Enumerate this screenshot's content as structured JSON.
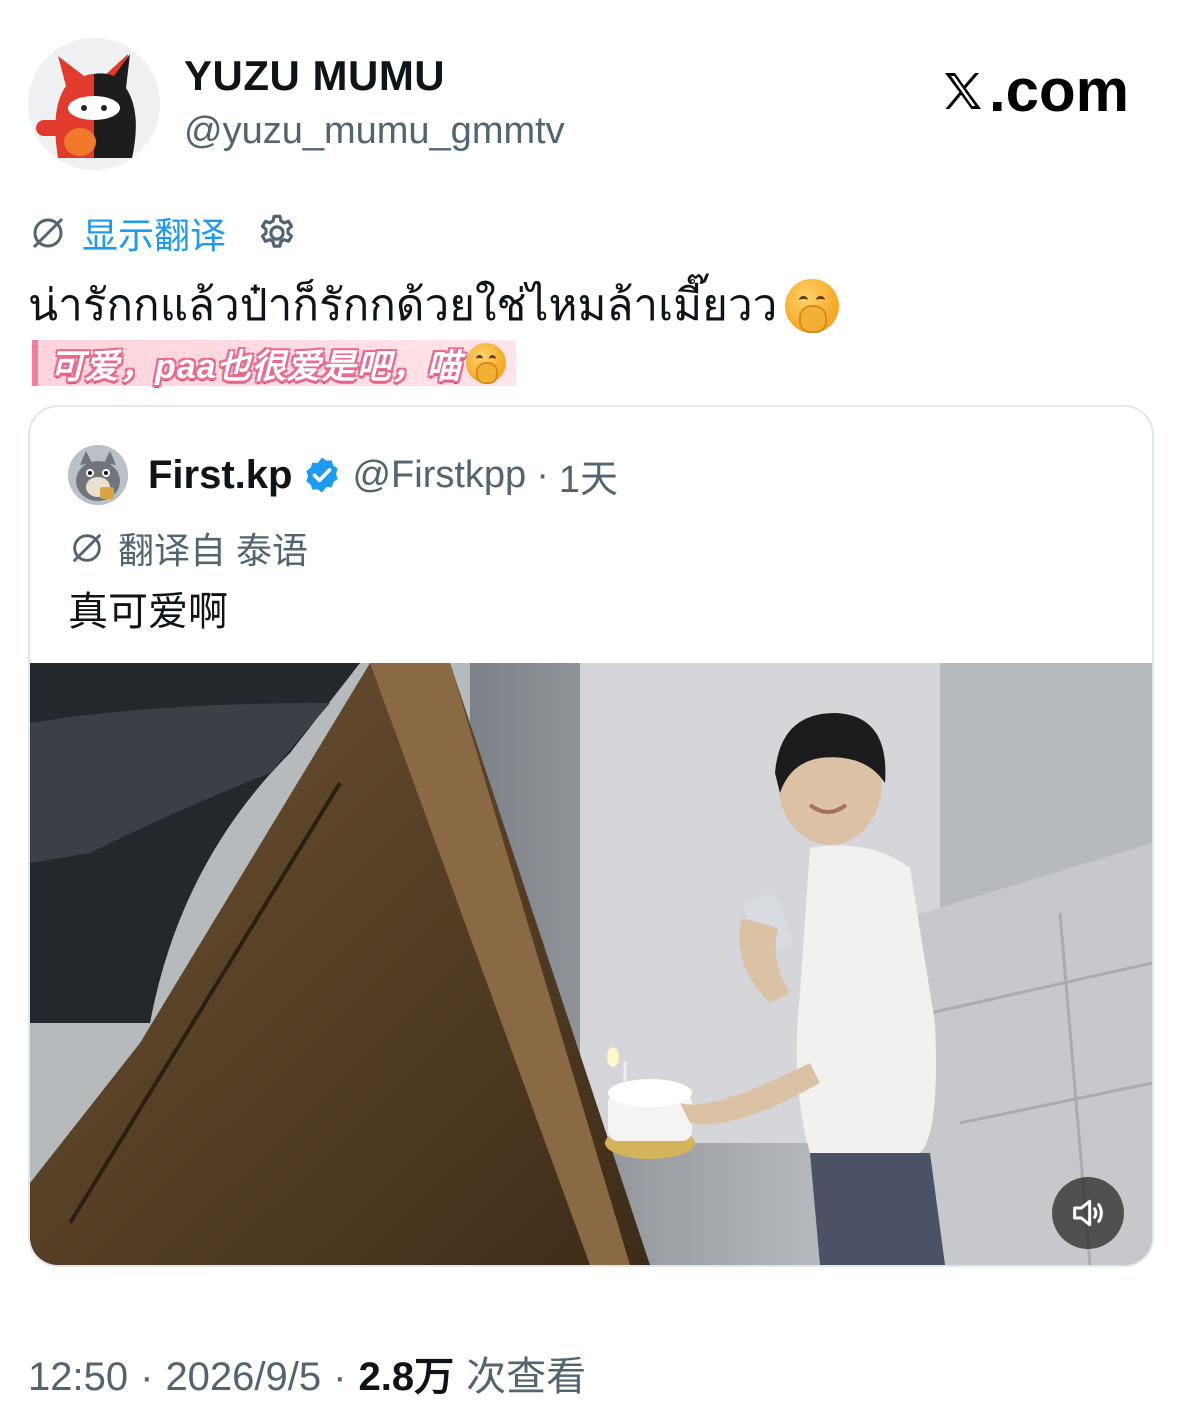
{
  "author": {
    "display_name": "YUZU MUMU",
    "handle": "@yuzu_mumu_gmmtv",
    "avatar_icon": "red-black-bear-plush-avatar"
  },
  "brand": {
    "label": ".com",
    "logo_icon": "x-logo-icon"
  },
  "translate": {
    "show_label": "显示翻译"
  },
  "post": {
    "text": "น่ารักกแล้วป๋าก็รักกด้วยใช่ไหมล้าเมี๊ยวว",
    "emoji": "hand-over-mouth-emoji",
    "subtitle": "可爱，paa也很爱是吧，喵"
  },
  "quote": {
    "display_name": "First.kp",
    "handle": "@Firstkpp",
    "separator": "·",
    "time": "1天",
    "translated_from": "翻译自 泰语",
    "text": "真可爱啊",
    "verified_icon": "verified-badge-icon",
    "media_icon": "video-still-man-with-cake"
  },
  "footer": {
    "time": "12:50",
    "date": "2026/9/5",
    "dot": "·",
    "views": "2.8万",
    "views_label": "次查看"
  },
  "colors": {
    "link": "#1d9bf0",
    "secondary": "#536471",
    "verified": "#1d9bf0",
    "subtitle_pink": "#f37fa0"
  }
}
